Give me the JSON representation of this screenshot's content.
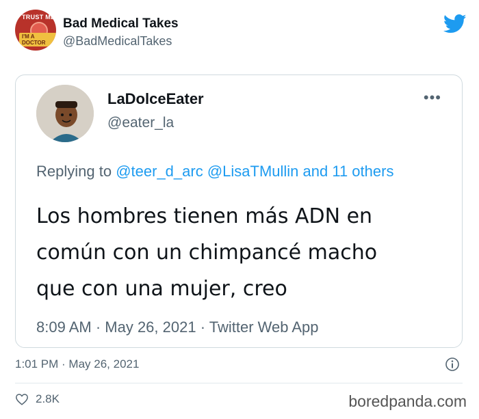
{
  "author": {
    "display_name": "Bad Medical Takes",
    "handle": "@BadMedicalTakes",
    "avatar_text_top": "TRUST ME",
    "avatar_text_bottom": "I'M A DOCTOR"
  },
  "quoted_tweet": {
    "display_name": "LaDolceEater",
    "handle": "@eater_la",
    "more": "•••",
    "reply_prefix": "Replying to",
    "reply_mentions": "@teer_d_arc @LisaTMullin and 11 others",
    "text_lines": [
      "Los hombres tienen más ADN en",
      "común con un chimpancé macho",
      "que con una mujer, creo"
    ],
    "meta": "8:09 AM · May 26, 2021 · Twitter Web App"
  },
  "tweet_meta": "1:01 PM · May 26, 2021",
  "likes": "2.8K",
  "watermark": "boredpanda.com",
  "colors": {
    "twitter_blue": "#1d9bf0",
    "secondary_text": "#536471"
  },
  "icons": {
    "logo": "twitter-bird-icon",
    "info": "info-icon",
    "like": "heart-icon"
  }
}
